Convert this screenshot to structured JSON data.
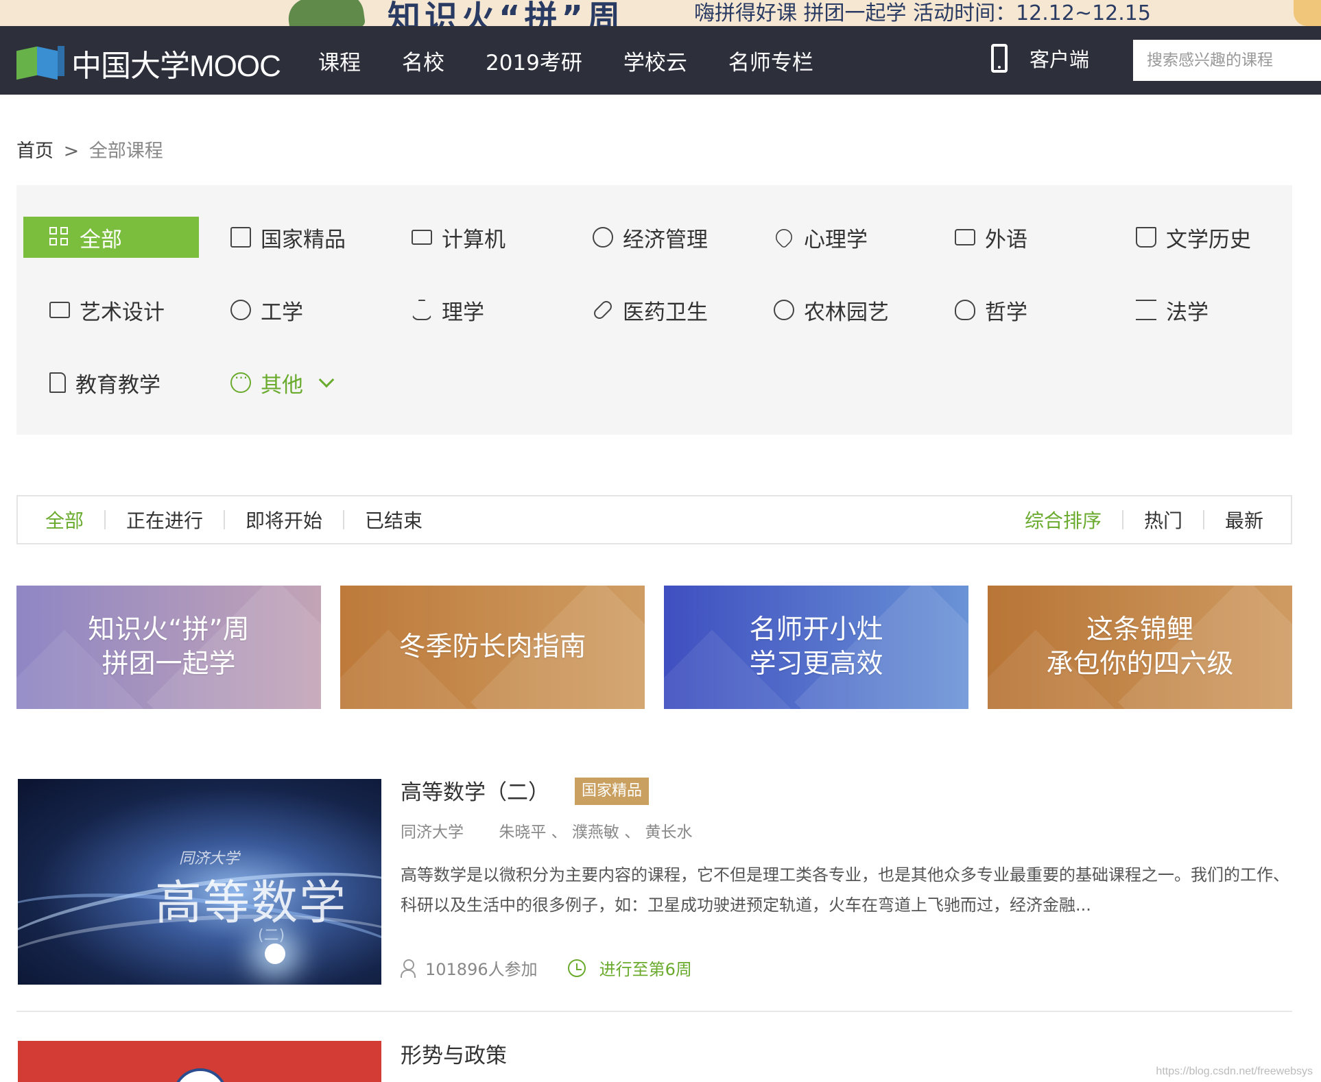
{
  "promo": {
    "headline": "知识火“拼”周",
    "subline": "嗨拼得好课 拼团一起学 活动时间：12.12~12.15"
  },
  "header": {
    "logo_text": "中国大学MOOC",
    "nav": [
      "课程",
      "名校",
      "2019考研",
      "学校云",
      "名师专栏"
    ],
    "client_label": "客户端",
    "search_placeholder": "搜索感兴趣的课程"
  },
  "breadcrumb": {
    "home": "首页",
    "separator": ">",
    "current": "全部课程"
  },
  "categories": [
    {
      "label": "全部",
      "icon": "grid-icon"
    },
    {
      "label": "国家精品",
      "icon": "star-badge-icon"
    },
    {
      "label": "计算机",
      "icon": "monitor-icon"
    },
    {
      "label": "经济管理",
      "icon": "dollar-icon"
    },
    {
      "label": "心理学",
      "icon": "heart-icon"
    },
    {
      "label": "外语",
      "icon": "chat-icon"
    },
    {
      "label": "文学历史",
      "icon": "book-icon"
    },
    {
      "label": "艺术设计",
      "icon": "image-icon"
    },
    {
      "label": "工学",
      "icon": "globe-icon"
    },
    {
      "label": "理学",
      "icon": "flask-icon"
    },
    {
      "label": "医药卫生",
      "icon": "pill-icon"
    },
    {
      "label": "农林园艺",
      "icon": "leaf-icon"
    },
    {
      "label": "哲学",
      "icon": "bulb-icon"
    },
    {
      "label": "法学",
      "icon": "scale-icon"
    },
    {
      "label": "教育教学",
      "icon": "document-icon"
    },
    {
      "label": "其他",
      "icon": "more-dots-icon"
    }
  ],
  "filters": {
    "status": [
      "全部",
      "正在进行",
      "即将开始",
      "已结束"
    ],
    "sort": [
      "综合排序",
      "热门",
      "最新"
    ]
  },
  "banners": [
    {
      "line1": "知识火“拼”周",
      "line2": "拼团一起学"
    },
    {
      "line1": "冬季防长肉指南",
      "line2": ""
    },
    {
      "line1": "名师开小灶",
      "line2": "学习更高效"
    },
    {
      "line1": "这条锦鲤",
      "line2": "承包你的四六级"
    }
  ],
  "courses": [
    {
      "title": "高等数学（二）",
      "tag": "国家精品",
      "school": "同济大学",
      "teachers": "朱晓平 、 濮燕敏 、 黄长水",
      "description": "高等数学是以微积分为主要内容的课程，它不但是理工类各专业，也是其他众多专业最重要的基础课程之一。我们的工作、科研以及生活中的很多例子，如：卫星成功驶进预定轨道，火车在弯道上飞驰而过，经济金融...",
      "enrolled": "101896人参加",
      "progress": "进行至第6周",
      "thumb_school": "同济大学",
      "thumb_title": "高等数学",
      "thumb_volume": "(二)"
    },
    {
      "title": "形势与政策"
    }
  ],
  "watermark": "https://blog.csdn.net/freewebsys",
  "colors": {
    "header_bg": "#2d303b",
    "accent_green": "#7bbe3e",
    "tag_gold": "#c9a060"
  }
}
